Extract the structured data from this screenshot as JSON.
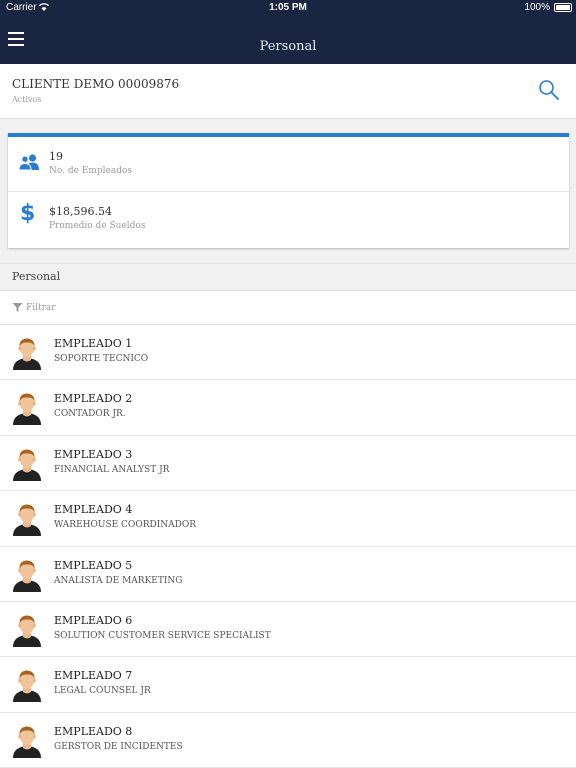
{
  "status_bar": {
    "carrier": "Carrier",
    "time": "1:05 PM",
    "battery": "100%"
  },
  "nav": {
    "title": "Personal",
    "menu_icon": "hamburger-menu-icon"
  },
  "client": {
    "name": "CLIENTE DEMO 00009876",
    "status": "Activos",
    "search_icon": "search-icon"
  },
  "stats": [
    {
      "value": "19",
      "label": "No. de Empleados",
      "icon": "users-icon"
    },
    {
      "value": "$18,596.54",
      "label": "Promedio de Sueldos",
      "icon": "dollar-icon"
    }
  ],
  "section": {
    "title": "Personal"
  },
  "filter": {
    "placeholder": "Filtrar",
    "icon": "filter-icon"
  },
  "employees": [
    {
      "name": "EMPLEADO 1",
      "role": "SOPORTE TECNICO"
    },
    {
      "name": "EMPLEADO 2",
      "role": "CONTADOR JR."
    },
    {
      "name": "EMPLEADO 3",
      "role": "FINANCIAL ANALYST JR"
    },
    {
      "name": "EMPLEADO 4",
      "role": "WAREHOUSE COORDINADOR"
    },
    {
      "name": "EMPLEADO 5",
      "role": "ANALISTA DE MARKETING"
    },
    {
      "name": "EMPLEADO 6",
      "role": "SOLUTION CUSTOMER SERVICE SPECIALIST"
    },
    {
      "name": "EMPLEADO 7",
      "role": "LEGAL COUNSEL JR"
    },
    {
      "name": "EMPLEADO 8",
      "role": "GERSTOR DE INCIDENTES"
    }
  ],
  "colors": {
    "navbar": "#1a2641",
    "accent": "#2a7dcc"
  }
}
